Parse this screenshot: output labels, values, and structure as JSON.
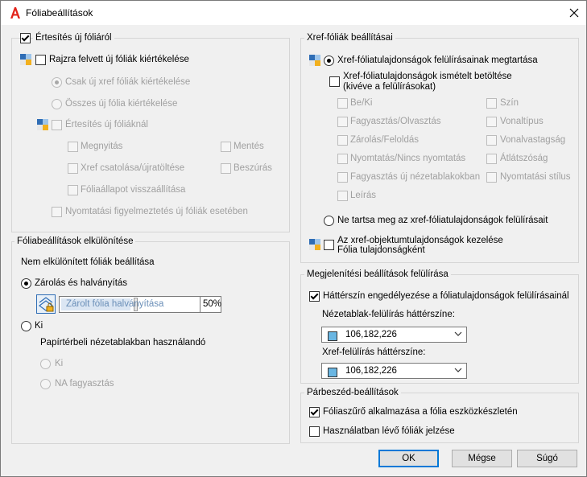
{
  "window": {
    "title": "Fóliabeállítások"
  },
  "notify": {
    "group_label": "Értesítés új fóliáról",
    "evaluate_label": "Rajzra felvett új fóliák kiértékelése",
    "only_xref_label": "Csak új xref fóliák kiértékelése",
    "all_layers_label": "Összes új fólia kiértékelése",
    "notify_new_label": "Értesítés új fóliáknál",
    "open_label": "Megnyitás",
    "save_label": "Mentés",
    "xref_attach_label": "Xref csatolása/újratöltése",
    "insert_label": "Beszúrás",
    "restore_state_label": "Fóliaállapot visszaállítása",
    "plot_warning_label": "Nyomtatási figyelmeztetés új fóliák esetében"
  },
  "isolate": {
    "group_label": "Fóliabeállítások elkülönítése",
    "section_label": "Nem elkülönített fóliák beállítása",
    "lock_fade_label": "Zárolás és halványítás",
    "fade_field_label": "Zárolt fólia halványítása",
    "fade_value": "50%",
    "fade_percent": 0.5,
    "off_label": "Ki",
    "paperspace_label": "Papírtérbeli nézetablakban használandó",
    "ps_off_label": "Ki",
    "ps_freeze_label": "NA fagyasztás"
  },
  "xref": {
    "group_label": "Xref-fóliák beállításai",
    "keep_overrides_label": "Xref-fóliatulajdonságok felülírásainak megtartása",
    "reload_line1": "Xref-fóliatulajdonságok ismételt betöltése",
    "reload_line2": "(kivéve a felülírásokat)",
    "props": {
      "on_off": "Be/Ki",
      "color": "Szín",
      "freeze_thaw": "Fagyasztás/Olvasztás",
      "linetype": "Vonaltípus",
      "lock_unlock": "Zárolás/Feloldás",
      "lineweight": "Vonalvastagság",
      "plot_noplot": "Nyomtatás/Nincs nyomtatás",
      "transparency": "Átlátszóság",
      "vp_freeze": "Fagyasztás új nézetablakokban",
      "plot_style": "Nyomtatási stílus",
      "description": "Leírás"
    },
    "no_keep_label": "Ne tartsa meg az xref-fóliatulajdonságok felülírásait",
    "manage_line1": "Az xref-objektumtulajdonságok kezelése",
    "manage_line2": "Fólia tulajdonságként"
  },
  "display": {
    "group_label": "Megjelenítési beállítások felülírása",
    "bg_enable_label": "Háttérszín engedélyezése a fóliatulajdonságok felülírásainál",
    "vp_bg_label": "Nézetablak-felülírás háttérszíne:",
    "vp_bg_value": "106,182,226",
    "xref_bg_label": "Xref-felülírás háttérszíne:",
    "xref_bg_value": "106,182,226",
    "swatch_color": "#6ab6e2"
  },
  "dialog": {
    "group_label": "Párbeszéd-beállítások",
    "apply_filter_label": "Fóliaszűrő alkalmazása a fólia eszközkészletén",
    "indicate_used_label": "Használatban lévő fóliák jelzése"
  },
  "buttons": {
    "ok": "OK",
    "cancel": "Mégse",
    "help": "Súgó"
  }
}
